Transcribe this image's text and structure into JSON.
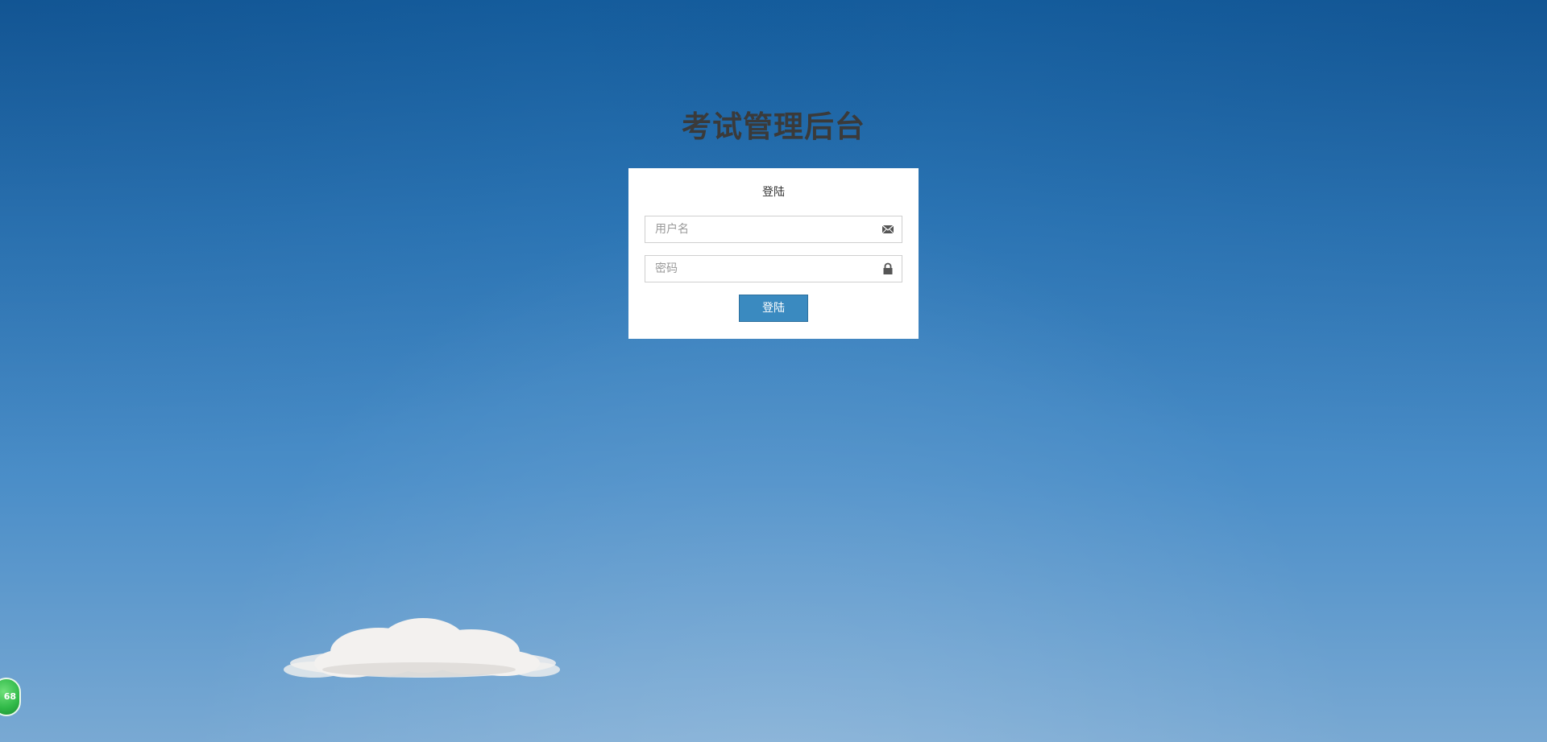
{
  "page": {
    "title": "考试管理后台"
  },
  "login_panel": {
    "heading": "登陆",
    "username_placeholder": "用户名",
    "password_placeholder": "密码",
    "username_icon": "envelope-icon",
    "password_icon": "lock-icon",
    "submit_label": "登陆"
  },
  "floating_badge": {
    "text": "68"
  },
  "colors": {
    "accent_button": "#3a8ac0",
    "title_text": "#3a3a3a",
    "sky_top": "#1661a2",
    "sky_bottom": "#79a9d3"
  }
}
